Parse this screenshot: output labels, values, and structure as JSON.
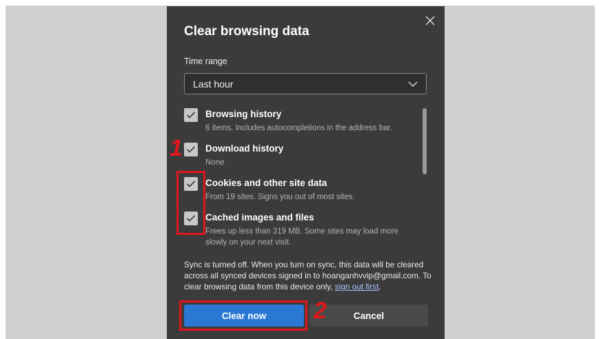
{
  "dialog": {
    "title": "Clear browsing data",
    "time_range": {
      "label": "Time range",
      "selected": "Last hour"
    },
    "items": [
      {
        "label": "Browsing history",
        "description": "6 items. Includes autocompletions in the address bar.",
        "checked": true
      },
      {
        "label": "Download history",
        "description": "None",
        "checked": true
      },
      {
        "label": "Cookies and other site data",
        "description": "From 19 sites. Signs you out of most sites.",
        "checked": true
      },
      {
        "label": "Cached images and files",
        "description": "Frees up less than 319 MB. Some sites may load more slowly on your next visit.",
        "checked": true
      }
    ],
    "sync_notice": {
      "text": "Sync is turned off. When you turn on sync, this data will be cleared across all synced devices signed in to hoanganhvvip@gmail.com. To clear browsing data from this device only,",
      "link": "sign out first",
      "end": "."
    },
    "buttons": {
      "clear": "Clear now",
      "cancel": "Cancel"
    }
  },
  "annotations": {
    "step1": "1",
    "step2": "2"
  },
  "colors": {
    "dialog_bg": "#3b3b3b",
    "primary": "#2a78d1",
    "annotation": "#e0161b"
  }
}
